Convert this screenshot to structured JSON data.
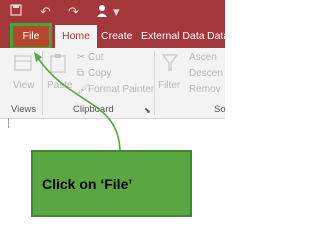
{
  "qat": {
    "icons": [
      "save-icon",
      "undo-icon",
      "redo-icon",
      "user-icon",
      "customize-icon"
    ],
    "undo_glyph": "↶",
    "redo_glyph": "↷",
    "dropdown_glyph": "▾"
  },
  "tabs": {
    "file": "File",
    "home": "Home",
    "create": "Create",
    "external_data": "External Data",
    "database_tools": "Data"
  },
  "ribbon": {
    "views": {
      "button_label": "View",
      "group_label": "Views"
    },
    "clipboard": {
      "paste_label": "Paste",
      "cut_label": "Cut",
      "copy_label": "Copy",
      "format_painter_label": "Format Painter",
      "group_label": "Clipboard",
      "launcher_glyph": "⬊"
    },
    "sort_filter": {
      "filter_label": "Filter",
      "ascending_label": "Ascen",
      "descending_label": "Descen",
      "remove_label": "Remov",
      "group_label": "So"
    }
  },
  "callout": {
    "text": "Click on ‘File’"
  },
  "colors": {
    "title_bar": "#a4373a",
    "file_tab": "#b7472a",
    "highlight": "#3ea83a",
    "callout_fill": "#5aa642",
    "ribbon": "#f3f3f3"
  }
}
